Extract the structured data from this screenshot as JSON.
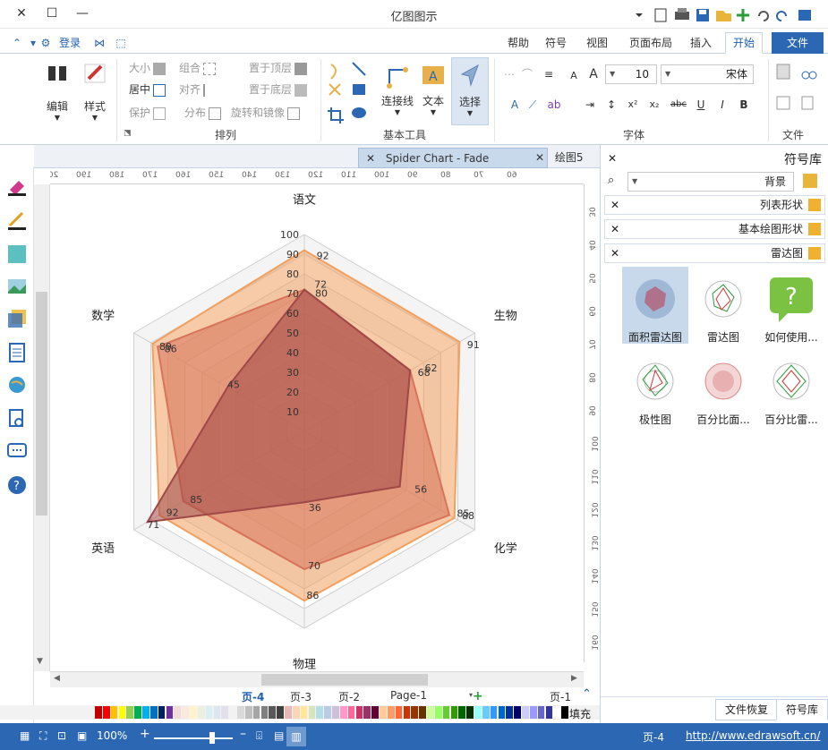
{
  "window": {
    "title": "亿图图示",
    "min_label": "—",
    "max_label": "☐",
    "close_label": "✕"
  },
  "quick": {
    "login_label": "登录"
  },
  "ribbon_tabs": [
    "文件",
    "开始",
    "插入",
    "页面布局",
    "视图",
    "符号",
    "帮助"
  ],
  "ribbon": {
    "file_group": {
      "label": "文件"
    },
    "font_group": {
      "label": "字体",
      "font_name": "宋体",
      "font_size": "10",
      "buttons": [
        "B",
        "I",
        "U",
        "abc",
        "x₂",
        "x²"
      ]
    },
    "tools_group": {
      "label": "基本工具",
      "select": "选择",
      "text": "文本",
      "connector": "连接线"
    },
    "arrange_group": {
      "label": "排列",
      "items": [
        "置于顶层",
        "置于底层",
        "旋转和镜像",
        "组合",
        "对齐",
        "分布",
        "大小",
        "居中",
        "保护"
      ]
    },
    "style_label": "样式",
    "edit_label": "编辑"
  },
  "doc_tabs": [
    {
      "label": "Spider Chart - Fade",
      "active": true
    },
    {
      "label": "绘图5",
      "active": false
    }
  ],
  "hruler_labels": [
    "60",
    "70",
    "80",
    "90",
    "100",
    "110",
    "120",
    "130",
    "140",
    "150",
    "160",
    "170",
    "180",
    "190",
    "200"
  ],
  "vruler_labels": [
    "30",
    "40",
    "50",
    "60",
    "70",
    "80",
    "90",
    "100",
    "110",
    "120",
    "130",
    "140",
    "150",
    "160",
    "170"
  ],
  "chart_data": {
    "type": "radar",
    "axes": [
      "语文",
      "生物",
      "化学",
      "物理",
      "英语",
      "数学"
    ],
    "ticks": [
      "10",
      "20",
      "30",
      "40",
      "50",
      "60",
      "70",
      "80",
      "90",
      "100"
    ],
    "rmax": 100,
    "series": [
      {
        "values": [
          92,
          91,
          88,
          86,
          85,
          89
        ],
        "color": "#f0a060"
      },
      {
        "values": [
          72,
          62,
          85,
          70,
          71,
          86
        ],
        "color": "#d8735a"
      },
      {
        "values": [
          72,
          62,
          56,
          36,
          92,
          45
        ],
        "color": "#a04848"
      }
    ],
    "value_labels": [
      "92",
      "80",
      "72",
      "91",
      "68",
      "62",
      "88",
      "85",
      "56",
      "86",
      "70",
      "36",
      "92",
      "85",
      "71",
      "89",
      "86",
      "45"
    ]
  },
  "page_tabs": [
    "页-1",
    "Page-1",
    "页-2",
    "页-3",
    "页-4"
  ],
  "page_tab_active": "页-4",
  "palette_label": "填充",
  "palette": [
    "#c00000",
    "#ff0000",
    "#ffc000",
    "#ffff00",
    "#92d050",
    "#00b050",
    "#00b0f0",
    "#0070c0",
    "#002060",
    "#7030a0",
    "#f2dcdb",
    "#fde9d9",
    "#fff2cc",
    "#ebf1de",
    "#dbeef3",
    "#dce6f1",
    "#e4dfec",
    "#f2f2f2",
    "#d9d9d9",
    "#bfbfbf",
    "#a6a6a6",
    "#808080",
    "#595959",
    "#404040",
    "#e6b8b7",
    "#fcd5b4",
    "#ffe699",
    "#d8e4bc",
    "#b7dee8",
    "#b8cce4",
    "#ccc0da",
    "#ff99cc",
    "#ff6699",
    "#cc3366",
    "#993366",
    "#660033",
    "#ffcc99",
    "#ff9966",
    "#ff6633",
    "#cc3300",
    "#993300",
    "#663300",
    "#ccff99",
    "#99ff66",
    "#66cc33",
    "#339900",
    "#006600",
    "#003300",
    "#99ffff",
    "#66ccff",
    "#3399ff",
    "#0066cc",
    "#003399",
    "#000066",
    "#ccccff",
    "#9999ff",
    "#6666cc",
    "#333399",
    "#ffffff",
    "#000000"
  ],
  "right_panel": {
    "title": "符号库",
    "search_value": "背景",
    "libraries": [
      "列表形状",
      "基本绘图形状",
      "雷达图"
    ],
    "shapes": [
      {
        "label": "面积雷达图",
        "selected": true
      },
      {
        "label": "雷达图",
        "selected": false
      },
      {
        "label": "如何使用...",
        "selected": false
      },
      {
        "label": "极性图",
        "selected": false
      },
      {
        "label": "百分比面...",
        "selected": false
      },
      {
        "label": "百分比雷...",
        "selected": false
      }
    ],
    "bottom_tabs": [
      "符号库",
      "文件恢复"
    ]
  },
  "status": {
    "url": "http://www.edrawsoft.cn/",
    "page": "页-4",
    "zoom": "100%"
  }
}
